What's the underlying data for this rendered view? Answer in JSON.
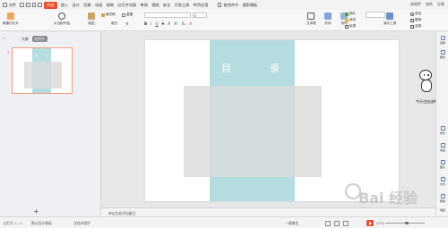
{
  "menubar": {
    "file_label": "文件",
    "tabs": [
      "开始",
      "插入",
      "设计",
      "切换",
      "动画",
      "放映",
      "幻灯片母版",
      "审阅",
      "视图",
      "安全",
      "开发工具",
      "特色应用"
    ],
    "active_tab": "开始",
    "search_label": "查找命令",
    "search_template_label": "搜索模板",
    "unsynced_label": "未同步",
    "collab_label": "协作",
    "share_label": "分享"
  },
  "ribbon": {
    "new_slide_label": "新建幻灯片",
    "from_current_label": "从当前开始",
    "paste_label": "粘贴",
    "format_painter_label": "格式刷",
    "layout_label": "版式",
    "section_label": "节",
    "reset_label": "重置",
    "font_value": "",
    "size_value": "0",
    "format_buttons": [
      "B",
      "I",
      "U",
      "S",
      "A",
      "X²",
      "X₂",
      "A"
    ],
    "textbox_label": "文本框",
    "shape_label": "形状",
    "arrange_label": "排列",
    "image_label": "图片",
    "fill_label": "填充",
    "outline_label": "轮廓",
    "find_label": "查找",
    "replace_label": "替换",
    "select_label": "选择",
    "slide_show_label": "演示工具"
  },
  "leftpane": {
    "tab_outline": "大纲",
    "tab_slides": "幻灯片",
    "slide_number": "1",
    "thumb_title_left": "目",
    "thumb_title_right": "录",
    "add_slide": "+"
  },
  "slide": {
    "title_left": "目",
    "title_right": "录",
    "band_color": "#b5dde0",
    "gray_color": "#e1e1e1"
  },
  "notes": {
    "placeholder": "单击此处添加备注"
  },
  "rightbar": {
    "tools": [
      "选择",
      "属性",
      "形状",
      "动画",
      "图片",
      "文件",
      "帮助",
      "收起"
    ]
  },
  "mascot": {
    "caption": "今天也加油鸭"
  },
  "statusbar": {
    "slide_info": "幻灯片 1 / 1",
    "theme": "默认设计模板",
    "doc_protect": "文档未保护",
    "smart": "一键美化",
    "zoom": "47%"
  },
  "watermark": {
    "text": "Bai 经验"
  }
}
